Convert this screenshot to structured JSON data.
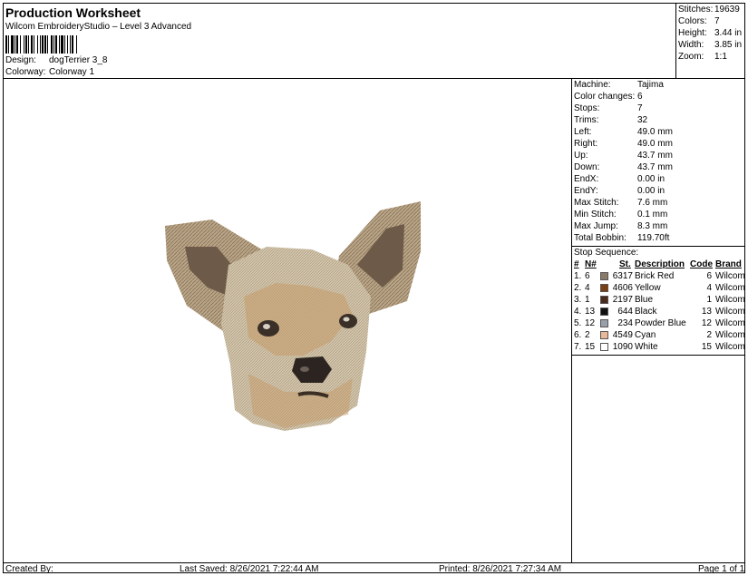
{
  "header": {
    "title": "Production Worksheet",
    "software": "Wilcom EmbroideryStudio – Level 3 Advanced",
    "design_label": "Design:",
    "design_value": "dogTerrier 3_8",
    "colorway_label": "Colorway:",
    "colorway_value": "Colorway 1"
  },
  "summary": [
    {
      "label": "Stitches:",
      "value": "19639"
    },
    {
      "label": "Colors:",
      "value": "7"
    },
    {
      "label": "Height:",
      "value": "3.44 in"
    },
    {
      "label": "Width:",
      "value": "3.85 in"
    },
    {
      "label": "Zoom:",
      "value": "1:1"
    }
  ],
  "machine_info": [
    {
      "label": "Machine:",
      "value": "Tajima"
    },
    {
      "label": "Color changes:",
      "value": "6"
    },
    {
      "label": "Stops:",
      "value": "7"
    },
    {
      "label": "Trims:",
      "value": "32"
    },
    {
      "label": "Left:",
      "value": "49.0 mm"
    },
    {
      "label": "Right:",
      "value": "49.0 mm"
    },
    {
      "label": "Up:",
      "value": "43.7 mm"
    },
    {
      "label": "Down:",
      "value": "43.7 mm"
    },
    {
      "label": "EndX:",
      "value": "0.00 in"
    },
    {
      "label": "EndY:",
      "value": "0.00 in"
    },
    {
      "label": "Max Stitch:",
      "value": "7.6 mm"
    },
    {
      "label": "Min Stitch:",
      "value": "0.1 mm"
    },
    {
      "label": "Max Jump:",
      "value": "8.3 mm"
    },
    {
      "label": "Total Bobbin:",
      "value": "119.70ft"
    }
  ],
  "stop_sequence": {
    "label": "Stop Sequence:",
    "headers": {
      "num": "#",
      "n": "N#",
      "st": "St.",
      "description": "Description",
      "code": "Code",
      "brand": "Brand"
    },
    "rows": [
      {
        "num": "1.",
        "n": "6",
        "color": "#8a7a6a",
        "st": "6317",
        "description": "Brick Red",
        "code": "6",
        "brand": "Wilcom"
      },
      {
        "num": "2.",
        "n": "4",
        "color": "#7a3e10",
        "st": "4606",
        "description": "Yellow",
        "code": "4",
        "brand": "Wilcom"
      },
      {
        "num": "3.",
        "n": "1",
        "color": "#4a2a1a",
        "st": "2197",
        "description": "Blue",
        "code": "1",
        "brand": "Wilcom"
      },
      {
        "num": "4.",
        "n": "13",
        "color": "#111111",
        "st": "644",
        "description": "Black",
        "code": "13",
        "brand": "Wilcom"
      },
      {
        "num": "5.",
        "n": "12",
        "color": "#9aa0aa",
        "st": "234",
        "description": "Powder Blue",
        "code": "12",
        "brand": "Wilcom"
      },
      {
        "num": "6.",
        "n": "2",
        "color": "#e8b898",
        "st": "4549",
        "description": "Cyan",
        "code": "2",
        "brand": "Wilcom"
      },
      {
        "num": "7.",
        "n": "15",
        "color": "#ffffff",
        "st": "1090",
        "description": "White",
        "code": "15",
        "brand": "Wilcom"
      }
    ]
  },
  "footer": {
    "created_by": "Created By:",
    "last_saved": "Last Saved: 8/26/2021 7:22:44 AM",
    "printed": "Printed: 8/26/2021 7:27:34 AM",
    "page": "Page 1 of 1"
  }
}
